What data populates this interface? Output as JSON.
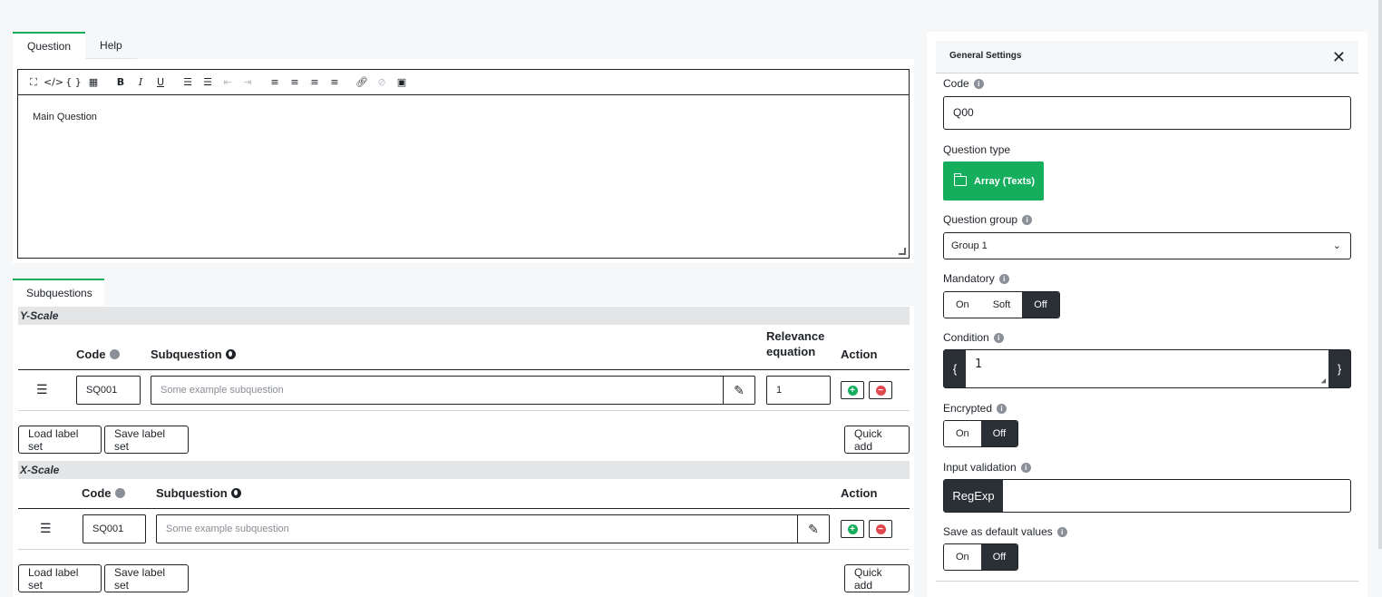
{
  "tabs": {
    "question": "Question",
    "help": "Help"
  },
  "editor": {
    "content": "Main Question"
  },
  "subquestions_tab": "Subquestions",
  "y_scale": {
    "title": "Y-Scale",
    "headers": {
      "code": "Code",
      "subquestion": "Subquestion",
      "relevance_1": "Relevance",
      "relevance_2": "equation",
      "action": "Action"
    },
    "row": {
      "code": "SQ001",
      "subquestion_placeholder": "Some example subquestion",
      "relevance": "1"
    }
  },
  "x_scale": {
    "title": "X-Scale",
    "headers": {
      "code": "Code",
      "subquestion": "Subquestion",
      "action": "Action"
    },
    "row": {
      "code": "SQ001",
      "subquestion_placeholder": "Some example subquestion"
    }
  },
  "buttons": {
    "load_label_set": "Load label set",
    "save_label_set": "Save label set",
    "quick_add": "Quick add"
  },
  "settings": {
    "title": "General Settings",
    "code_label": "Code",
    "code_value": "Q00",
    "question_type_label": "Question type",
    "question_type_value": "Array (Texts)",
    "question_group_label": "Question group",
    "question_group_value": "Group 1",
    "mandatory_label": "Mandatory",
    "mandatory_options": [
      "On",
      "Soft",
      "Off"
    ],
    "mandatory_selected": "Off",
    "condition_label": "Condition",
    "condition_open": "{",
    "condition_close": "}",
    "condition_value": "1",
    "encrypted_label": "Encrypted",
    "encrypted_options": [
      "On",
      "Off"
    ],
    "encrypted_selected": "Off",
    "input_validation_label": "Input validation",
    "input_validation_prefix": "RegExp",
    "save_default_label": "Save as default values",
    "save_default_options": [
      "On",
      "Off"
    ],
    "save_default_selected": "Off"
  },
  "colors": {
    "accent": "#14ae5c",
    "dark": "#2b2f36",
    "remove": "#e0484d"
  }
}
